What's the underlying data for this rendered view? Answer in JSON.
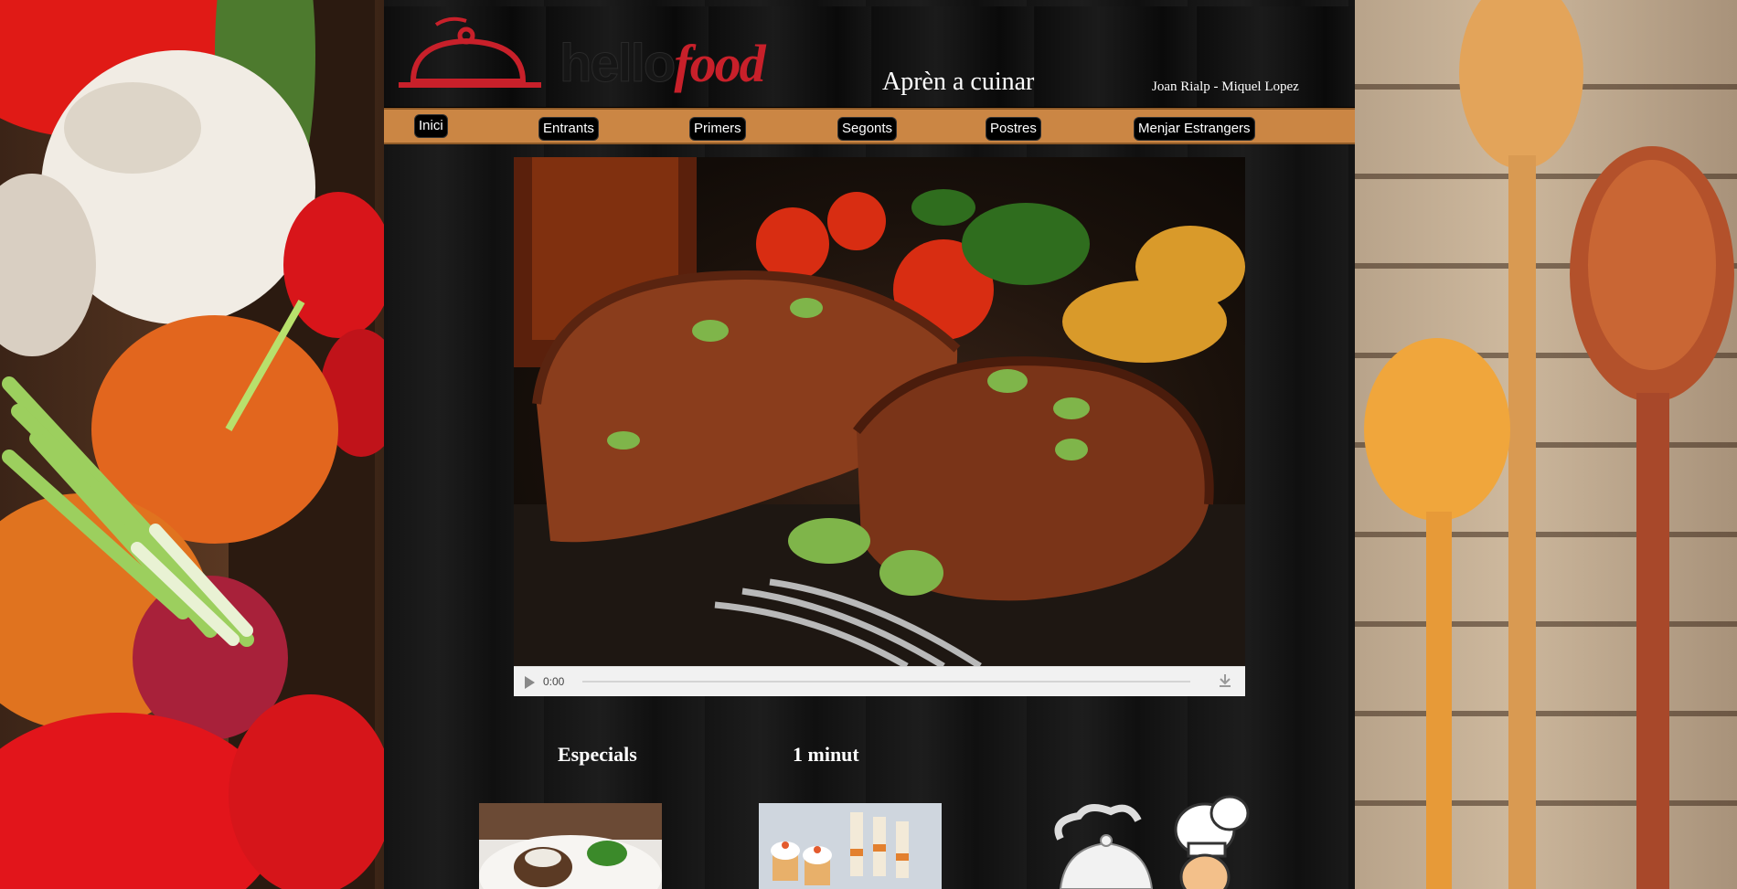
{
  "header": {
    "logo_hello": "hello",
    "logo_food": "food",
    "tagline": "Aprèn a cuinar",
    "authors": "Joan Rialp - Miquel Lopez"
  },
  "nav": {
    "items": [
      {
        "label": "Inici"
      },
      {
        "label": "Entrants"
      },
      {
        "label": "Primers"
      },
      {
        "label": "Segonts"
      },
      {
        "label": "Postres"
      },
      {
        "label": "Menjar Estrangers"
      }
    ]
  },
  "media": {
    "time": "0:00",
    "progress": 0
  },
  "sections": {
    "especials": "Especials",
    "minut": "1 minut"
  },
  "colors": {
    "nav_bar": "#cb8644",
    "brand_red": "#c8202a",
    "panel": "#151515"
  },
  "icons": [
    "play-icon",
    "download-icon",
    "cloche-logo-icon"
  ]
}
